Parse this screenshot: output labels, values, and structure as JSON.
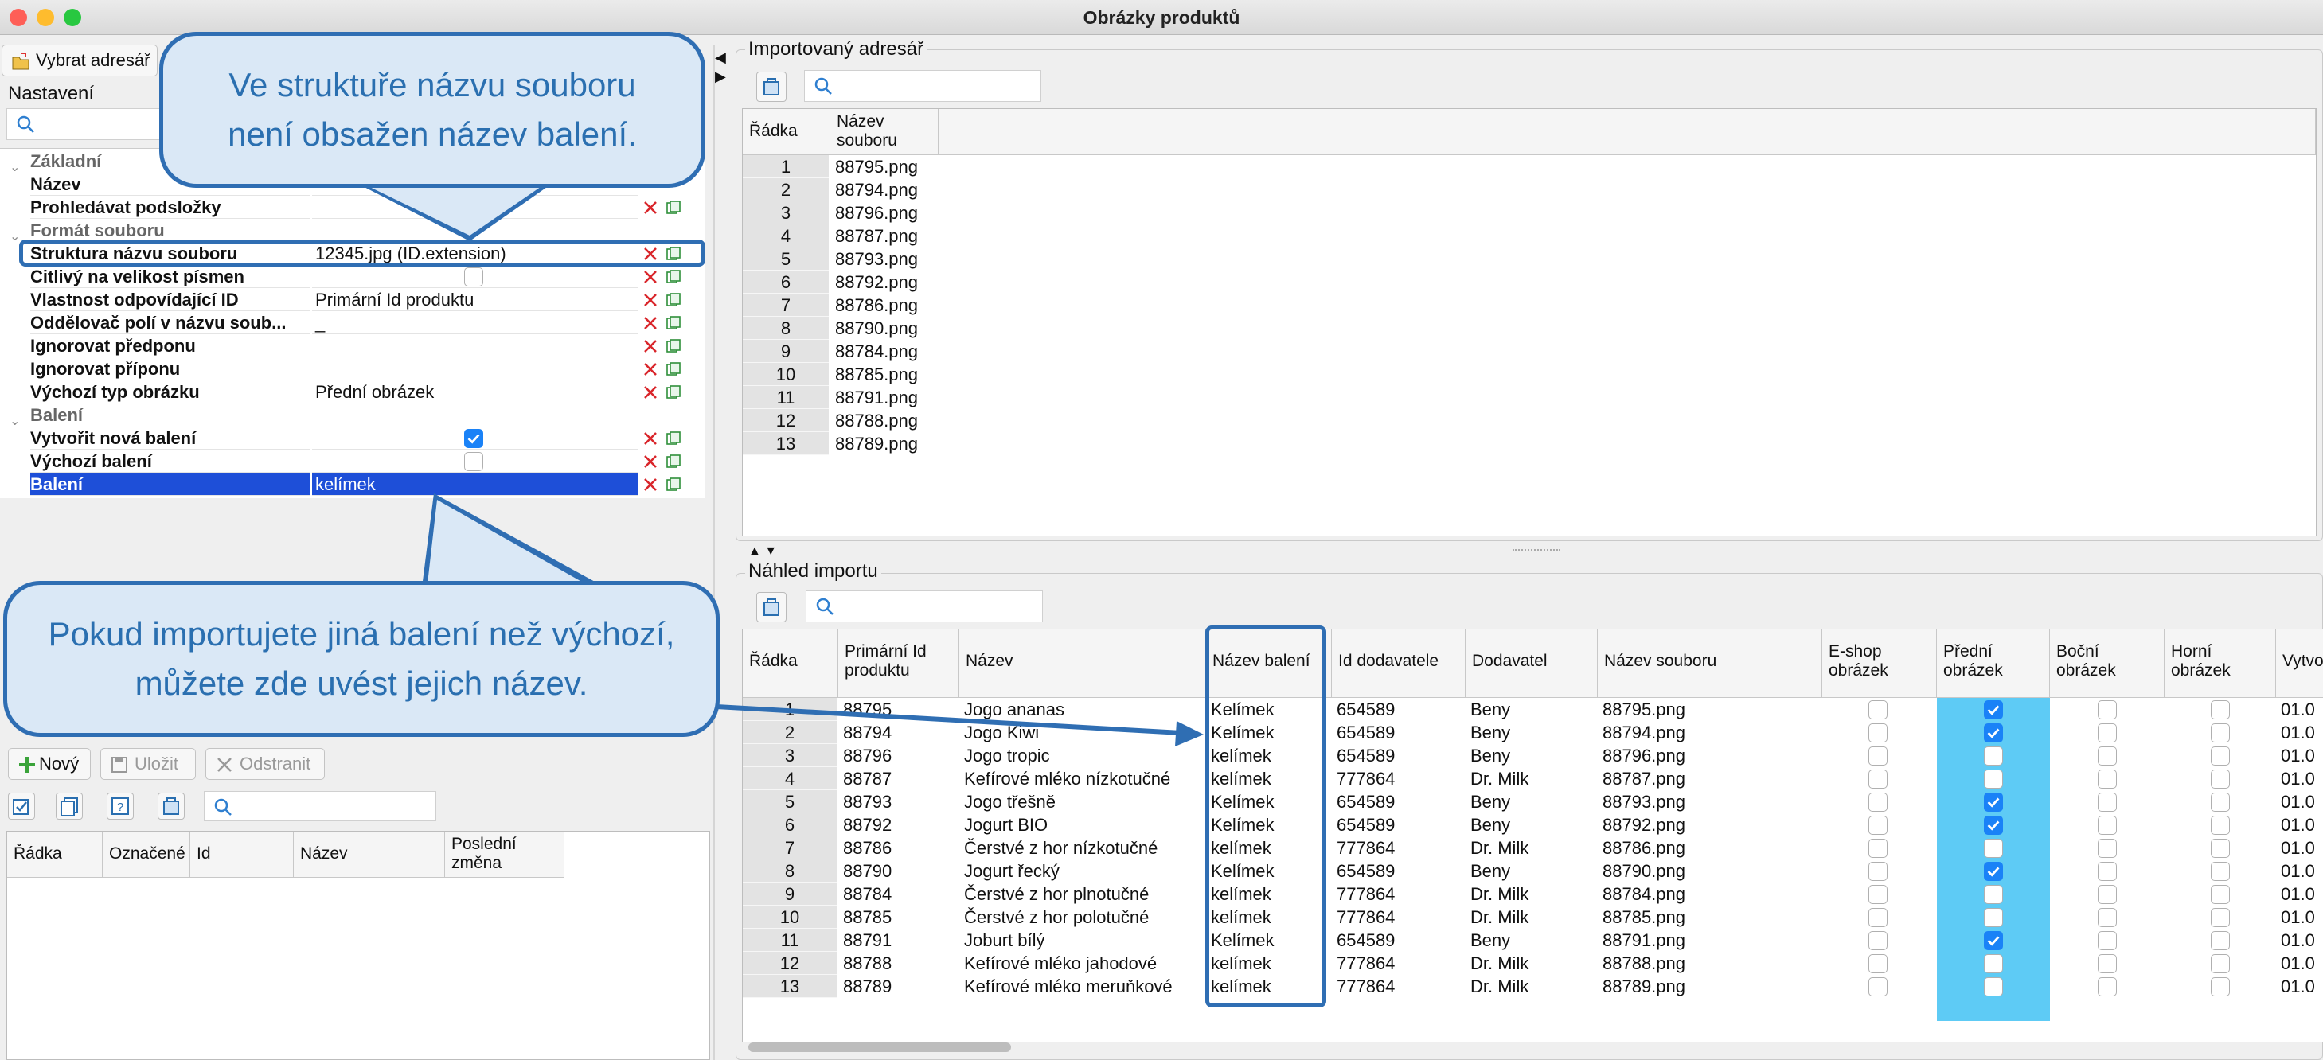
{
  "window": {
    "title": "Obrázky produktů"
  },
  "left": {
    "choose_dir_label": "Vybrat adresář",
    "settings_title": "Nastavení",
    "properties": [
      {
        "type": "cat",
        "label": "Základní"
      },
      {
        "type": "prop",
        "name": "Název",
        "value": ""
      },
      {
        "type": "prop",
        "name": "Prohledávat podsložky",
        "value": ""
      },
      {
        "type": "cat",
        "label": "Formát souboru"
      },
      {
        "type": "prop",
        "name": "Struktura názvu souboru",
        "value": "12345.jpg (ID.extension)"
      },
      {
        "type": "prop",
        "name": "Citlivý na velikost písmen",
        "value": ""
      },
      {
        "type": "prop",
        "name": "Vlastnost odpovídající ID",
        "value": "Primární Id produktu"
      },
      {
        "type": "prop",
        "name": "Oddělovač polí v názvu soub...",
        "value": "_"
      },
      {
        "type": "prop",
        "name": "Ignorovat předponu",
        "value": ""
      },
      {
        "type": "prop",
        "name": "Ignorovat příponu",
        "value": ""
      },
      {
        "type": "prop",
        "name": "Výchozí typ obrázku",
        "value": "Přední obrázek"
      },
      {
        "type": "cat",
        "label": "Balení"
      },
      {
        "type": "prop",
        "name": "Vytvořit nová balení",
        "value": ""
      },
      {
        "type": "prop",
        "name": "Výchozí balení",
        "value": ""
      },
      {
        "type": "prop",
        "name": "Balení",
        "value": "kelímek"
      }
    ],
    "checkbox_states": {
      "prohledavat": false,
      "citlivy": false,
      "vytvorit": true,
      "vychozi": false
    },
    "toolbar": {
      "new": "Nový",
      "save": "Uložit",
      "remove": "Odstranit"
    },
    "headers": [
      "Řádka",
      "Označené",
      "Id",
      "Název",
      "Poslední změna"
    ]
  },
  "imported": {
    "title": "Importovaný adresář",
    "headers": [
      "Řádka",
      "Název souboru"
    ],
    "rows": [
      [
        "1",
        "88795.png"
      ],
      [
        "2",
        "88794.png"
      ],
      [
        "3",
        "88796.png"
      ],
      [
        "4",
        "88787.png"
      ],
      [
        "5",
        "88793.png"
      ],
      [
        "6",
        "88792.png"
      ],
      [
        "7",
        "88786.png"
      ],
      [
        "8",
        "88790.png"
      ],
      [
        "9",
        "88784.png"
      ],
      [
        "10",
        "88785.png"
      ],
      [
        "11",
        "88791.png"
      ],
      [
        "12",
        "88788.png"
      ],
      [
        "13",
        "88789.png"
      ]
    ]
  },
  "preview": {
    "title": "Náhled importu",
    "headers": [
      "Řádka",
      "Primární Id produktu",
      "Název",
      "Název balení",
      "Id dodavatele",
      "Dodavatel",
      "Název souboru",
      "E-shop obrázek",
      "Přední obrázek",
      "Boční obrázek",
      "Horní obrázek",
      "Vytvo"
    ],
    "rows": [
      {
        "n": "1",
        "id": "88795",
        "name": "Jogo ananas",
        "pack": "Kelímek",
        "sid": "654589",
        "sup": "Beny",
        "file": "88795.png",
        "front": true,
        "date": "01.0"
      },
      {
        "n": "2",
        "id": "88794",
        "name": "Jogo Kiwi",
        "pack": "Kelímek",
        "sid": "654589",
        "sup": "Beny",
        "file": "88794.png",
        "front": true,
        "date": "01.0"
      },
      {
        "n": "3",
        "id": "88796",
        "name": "Jogo tropic",
        "pack": "kelímek",
        "sid": "654589",
        "sup": "Beny",
        "file": "88796.png",
        "front": false,
        "date": "01.0"
      },
      {
        "n": "4",
        "id": "88787",
        "name": "Kefírové mléko nízkotučné",
        "pack": "kelímek",
        "sid": "777864",
        "sup": "Dr. Milk",
        "file": "88787.png",
        "front": false,
        "date": "01.0"
      },
      {
        "n": "5",
        "id": "88793",
        "name": "Jogo třešně",
        "pack": "Kelímek",
        "sid": "654589",
        "sup": "Beny",
        "file": "88793.png",
        "front": true,
        "date": "01.0"
      },
      {
        "n": "6",
        "id": "88792",
        "name": "Jogurt BIO",
        "pack": "Kelímek",
        "sid": "654589",
        "sup": "Beny",
        "file": "88792.png",
        "front": true,
        "date": "01.0"
      },
      {
        "n": "7",
        "id": "88786",
        "name": "Čerstvé z hor nízkotučné",
        "pack": "kelímek",
        "sid": "777864",
        "sup": "Dr. Milk",
        "file": "88786.png",
        "front": false,
        "date": "01.0"
      },
      {
        "n": "8",
        "id": "88790",
        "name": "Jogurt řecký",
        "pack": "Kelímek",
        "sid": "654589",
        "sup": "Beny",
        "file": "88790.png",
        "front": true,
        "date": "01.0"
      },
      {
        "n": "9",
        "id": "88784",
        "name": "Čerstvé z hor plnotučné",
        "pack": "kelímek",
        "sid": "777864",
        "sup": "Dr. Milk",
        "file": "88784.png",
        "front": false,
        "date": "01.0"
      },
      {
        "n": "10",
        "id": "88785",
        "name": "Čerstvé z hor polotučné",
        "pack": "kelímek",
        "sid": "777864",
        "sup": "Dr. Milk",
        "file": "88785.png",
        "front": false,
        "date": "01.0"
      },
      {
        "n": "11",
        "id": "88791",
        "name": "Joburt bílý",
        "pack": "Kelímek",
        "sid": "654589",
        "sup": "Beny",
        "file": "88791.png",
        "front": true,
        "date": "01.0"
      },
      {
        "n": "12",
        "id": "88788",
        "name": "Kefírové mléko jahodové",
        "pack": "kelímek",
        "sid": "777864",
        "sup": "Dr. Milk",
        "file": "88788.png",
        "front": false,
        "date": "01.0"
      },
      {
        "n": "13",
        "id": "88789",
        "name": "Kefírové mléko meruňkové",
        "pack": "kelímek",
        "sid": "777864",
        "sup": "Dr. Milk",
        "file": "88789.png",
        "front": false,
        "date": "01.0"
      }
    ]
  },
  "callouts": {
    "top": "Ve struktuře názvu souboru není obsažen název balení.",
    "bottom": "Pokud importujete jiná balení než výchozí, můžete zde uvést jejich název."
  },
  "colors": {
    "accent": "#2f6eb3",
    "selected_row": "#1e4fd8",
    "front_col": "#5ecbf5",
    "checkbox_on": "#1a82f7",
    "delete_x": "#d9252a"
  }
}
